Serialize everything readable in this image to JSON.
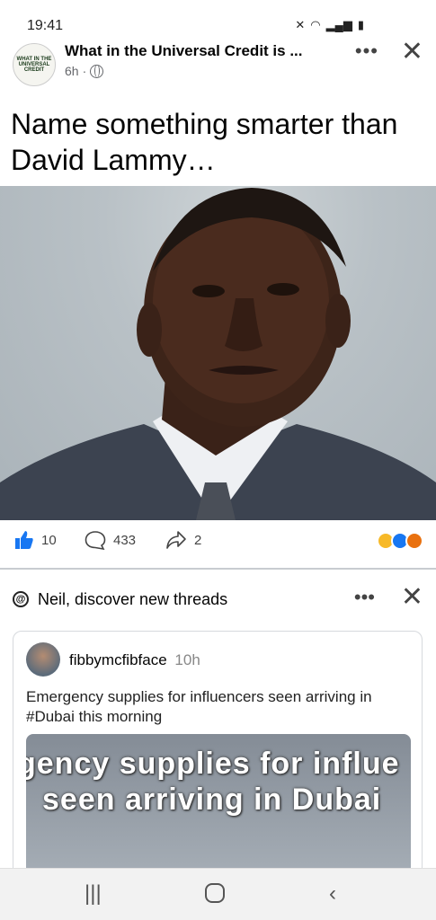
{
  "status_bar": {
    "time": "19:41"
  },
  "post": {
    "page_name": "What in the Universal Credit is ...",
    "page_logo_text": "WHAT IN THE UNIVERSAL CREDIT",
    "time_ago": "6h",
    "text": "Name something smarter than David Lammy…",
    "likes": "10",
    "comments": "433",
    "shares": "2"
  },
  "threads_section": {
    "title": "Neil, discover new threads",
    "card": {
      "username": "fibbymcfibface",
      "time_ago": "10h",
      "text": "Emergency supplies for influencers seen arriving in #Dubai this morning",
      "image_text_line1": "gency supplies for influe",
      "image_text_line2": "seen arriving in Dubai"
    }
  },
  "colors": {
    "accent": "#1877f2",
    "text_primary": "#050505",
    "text_secondary": "#65676b"
  }
}
